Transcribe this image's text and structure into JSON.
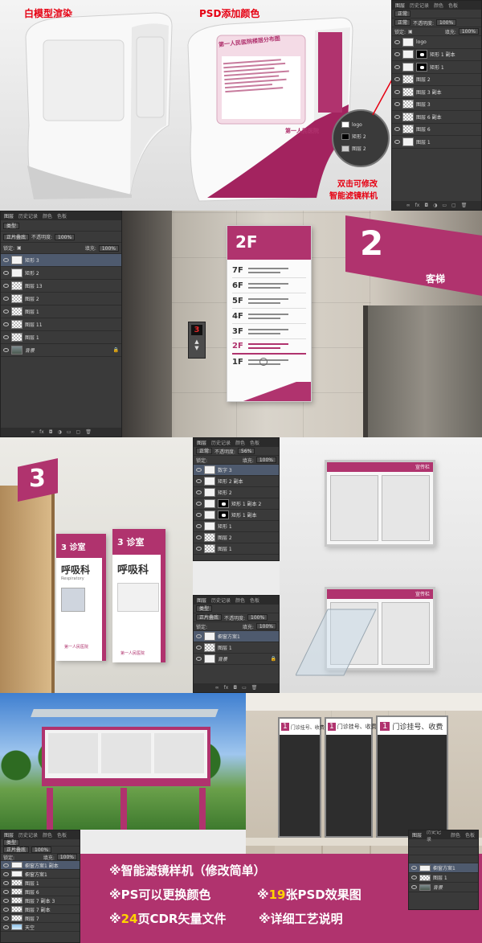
{
  "colors": {
    "accent": "#b0336e",
    "panel": "#3a3a3a",
    "caption_red": "#e60012",
    "bottom_bar": "#b0336e"
  },
  "section1": {
    "left_caption": "白模型渲染",
    "right_caption": "PSD添加颜色",
    "sign_title": "第一人民医院楼层分布图",
    "hospital_name": "第一人民医院",
    "callout_line1": "双击可修改",
    "callout_line2": "智能滤镜样机",
    "zoom_layers": [
      "logo",
      "矩形 2",
      "图层 2"
    ]
  },
  "panel_a": {
    "tabs": [
      "图层",
      "历史记录",
      "颜色",
      "色板"
    ],
    "kind": "正常",
    "opacity_label": "不透明度:",
    "opacity": "100%",
    "lock_label": "锁定:",
    "fill_label": "填充:",
    "fill": "100%",
    "layers": [
      "logo",
      "矩形 1 副本",
      "矩形 1",
      "图层 2",
      "图层 3 副本",
      "图层 3",
      "图层 6 副本",
      "图层 6",
      "图层 1"
    ]
  },
  "panel_b": {
    "tabs": [
      "图层",
      "历史记录",
      "颜色",
      "色板"
    ],
    "kind": "类型",
    "blend": "正片叠底",
    "opacity_label": "不透明度:",
    "opacity": "100%",
    "lock_label": "锁定:",
    "fill_label": "填充:",
    "fill": "100%",
    "layers": [
      "矩形 3",
      "矩形 2",
      "图层 13",
      "图层 2",
      "图层 1",
      "图层 11",
      "图层 1",
      "背景"
    ]
  },
  "elevator": {
    "floor_badge": "2F",
    "panel_digit": "3",
    "lobby_number": "2",
    "lobby_text": "客梯",
    "floors": [
      "7F",
      "6F",
      "5F",
      "4F",
      "3F",
      "2F",
      "1F"
    ]
  },
  "clinic": {
    "room_number": "3",
    "sign_label": "3 诊室",
    "dept": "呼吸科",
    "dept_en": "Respiratory",
    "hospital": "第一人民医院"
  },
  "panel_c": {
    "tabs": [
      "图层",
      "历史记录",
      "颜色",
      "色板"
    ],
    "kind": "正常",
    "opacity_label": "不透明度:",
    "opacity": "56%",
    "lock_label": "锁定:",
    "fill_label": "填充:",
    "fill": "100%",
    "layers": [
      "数字 3",
      "矩形 2 副本",
      "矩形 2",
      "矩形 1 副本 2",
      "矩形 1 副本",
      "矩形 1",
      "图层 2",
      "图层 1"
    ]
  },
  "panel_d": {
    "tabs": [
      "图层",
      "历史记录",
      "颜色",
      "色板"
    ],
    "kind": "类型",
    "blend": "正片叠底",
    "opacity_label": "不透明度:",
    "opacity": "100%",
    "lock_label": "锁定:",
    "fill_label": "填充:",
    "fill": "100%",
    "layers": [
      "橱窗方案1",
      "图层 1",
      "背景"
    ]
  },
  "bulletin": {
    "badge": "宣传栏"
  },
  "counters": {
    "items": [
      {
        "num": "1",
        "label": "门诊挂号、收费"
      },
      {
        "num": "1",
        "label": "门诊挂号、收费"
      },
      {
        "num": "1",
        "label": "门诊挂号、收费"
      }
    ]
  },
  "panel_e": {
    "tabs": [
      "图层",
      "历史记录",
      "颜色",
      "色板"
    ],
    "kind": "类型",
    "blend": "正片叠底",
    "opacity_label": "不透明度:",
    "opacity": "100%",
    "lock_label": "锁定:",
    "fill_label": "填充:",
    "fill": "100%",
    "layers": [
      "橱窗方案1 副本",
      "橱窗方案1",
      "图层 1",
      "图层 6",
      "图层 7 副本 3",
      "图层 7 副本",
      "图层 7",
      "天空"
    ]
  },
  "panel_f": {
    "tabs": [
      "图层",
      "历史记录",
      "颜色",
      "色板"
    ],
    "layers": [
      "橱窗方案1",
      "图层 1",
      "背景"
    ]
  },
  "bottom": {
    "line1": "※智能滤镜样机（修改简单）",
    "line2a": "※PS可以更换颜色",
    "line2b_pre": "※",
    "line2b_num": "19",
    "line2b_post": "张PSD效果图",
    "line3a_pre": "※",
    "line3a_num": "24",
    "line3a_post": "页CDR矢量文件",
    "line3b": "※详细工艺说明"
  },
  "icons": {
    "eye": "eye-icon",
    "lock": "lock-icon",
    "folder": "folder-icon",
    "trash": "trash-icon",
    "link": "link-icon",
    "fx": "fx-icon"
  }
}
